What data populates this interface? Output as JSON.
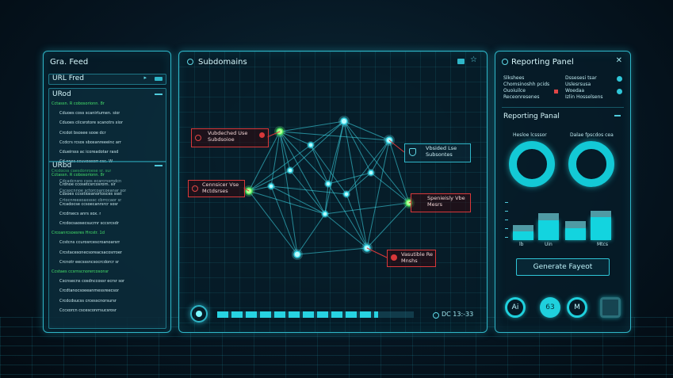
{
  "feed_panel": {
    "title": "Gra. Feed",
    "url_field_label": "URL Fred",
    "section_1": "URod",
    "section_2": "URbd",
    "section_1_lines": [
      {
        "t": "Cctassn. R cobosorionn. 8r",
        "c": "green"
      },
      {
        "t": "Cduoes coss scanirtumen. sior",
        "c": "pale"
      },
      {
        "t": "Cduoes ciicsrotore scanotrs xior",
        "c": "pale"
      },
      {
        "t": "Crcdot bsosee sooe dcr",
        "c": "pale"
      },
      {
        "t": "Ccdcrs rcsos sboxanreeeinc arr",
        "c": "pale"
      },
      {
        "t": "Cdueirsss ac icoreadotar rasd",
        "c": "pale"
      },
      {
        "t": "Cd.enes ccuvoseorr csc. W",
        "c": "pale"
      },
      {
        "t": "Crcdocss caesdonroese sr. sur",
        "c": "green"
      },
      {
        "t": "Cdcadcnsro csos ecarcrssmdcn",
        "c": "pale"
      },
      {
        "t": "Cscaxcnnoe sctorcoarcoeanar sor",
        "c": "pale"
      },
      {
        "t": "Crtocnreexoaxsssc cbrrccaor sr",
        "c": "pale"
      }
    ],
    "section_2_lines": [
      {
        "t": "Cctassn. R cobosorionn. 8r",
        "c": "green"
      },
      {
        "t": "Crdnoe ccosetcsrcosrorn. sir",
        "c": "pale"
      },
      {
        "t": "Cdxoes ccsstioxanortosces ssst",
        "c": "pale"
      },
      {
        "t": "Crcadocse ccsoecanrsrcr sosr",
        "c": "pale"
      },
      {
        "t": "Crcdrsecs anrs xox. r",
        "c": "pale"
      },
      {
        "t": "Crcdocsaosecsucrnr sccsrcsdr",
        "c": "pale"
      },
      {
        "t": "Crcoanrcsoesres Hrcstr. 1d",
        "c": "green"
      },
      {
        "t": "Ccstcns ccurosrcescroanoarsrr",
        "c": "pale"
      },
      {
        "t": "Crcstacesonecsoreacsacosrroer",
        "c": "pale"
      },
      {
        "t": "Crcnotr eecsssncsocrcdorcr sr",
        "c": "pale"
      },
      {
        "t": "Ccstaes ccsrnscnorercosonsr",
        "c": "green"
      },
      {
        "t": "Cxcnsecns cosdnccossr ecrsr sor",
        "c": "pale"
      },
      {
        "t": "Crcdtanocsoeeanmessreecsor",
        "c": "pale"
      },
      {
        "t": "Crcdcdsucss crcesscnorsursr",
        "c": "pale"
      },
      {
        "t": "Cccxorcn cscesconrrsucsrosr",
        "c": "pale"
      }
    ]
  },
  "center_panel": {
    "title": "Subdomains",
    "callouts": [
      {
        "text1": "Vubdeched Use",
        "text2": "Subdsoioe"
      },
      {
        "text1": "Cennsicer Vse",
        "text2": "Mctdsrses"
      },
      {
        "text1": "Vbsided Lse",
        "text2": "Subsontes"
      },
      {
        "text1": "Spenieisly Vbe",
        "text2": "Mesrs"
      },
      {
        "text1": "Vasutible Re",
        "text2": "Mnshs"
      }
    ],
    "progress_readout": "DC 13:-33",
    "progress_percent": 82
  },
  "report_panel": {
    "title": "Reporting Panel",
    "close_label": "✕",
    "meta_rows": [
      {
        "a": "Slkshees",
        "b": "Dssesesi tsar"
      },
      {
        "a": "Chomsinoshh pcids",
        "b": "Uslesrsusa"
      },
      {
        "a": "Ouoiuilce",
        "b": "Woedaa"
      },
      {
        "a": "Receonresenes",
        "b": "Izlin Hosselsens"
      }
    ],
    "section_title": "Reporting Panal",
    "donut_labels": [
      "Hesloe lcsssor",
      "Dalae fpscdos cea"
    ],
    "bars_axis_labels": [
      "lb",
      "Uin",
      "",
      "Mtcs"
    ],
    "bar_values": [
      {
        "base": 0.22,
        "top": 0.18
      },
      {
        "base": 0.52,
        "top": 0.18
      },
      {
        "base": 0.32,
        "top": 0.18
      },
      {
        "base": 0.6,
        "top": 0.18
      }
    ],
    "generate_button": "Generate Fayeot",
    "ring_icons": [
      "Ai",
      "63",
      "M",
      ""
    ]
  }
}
